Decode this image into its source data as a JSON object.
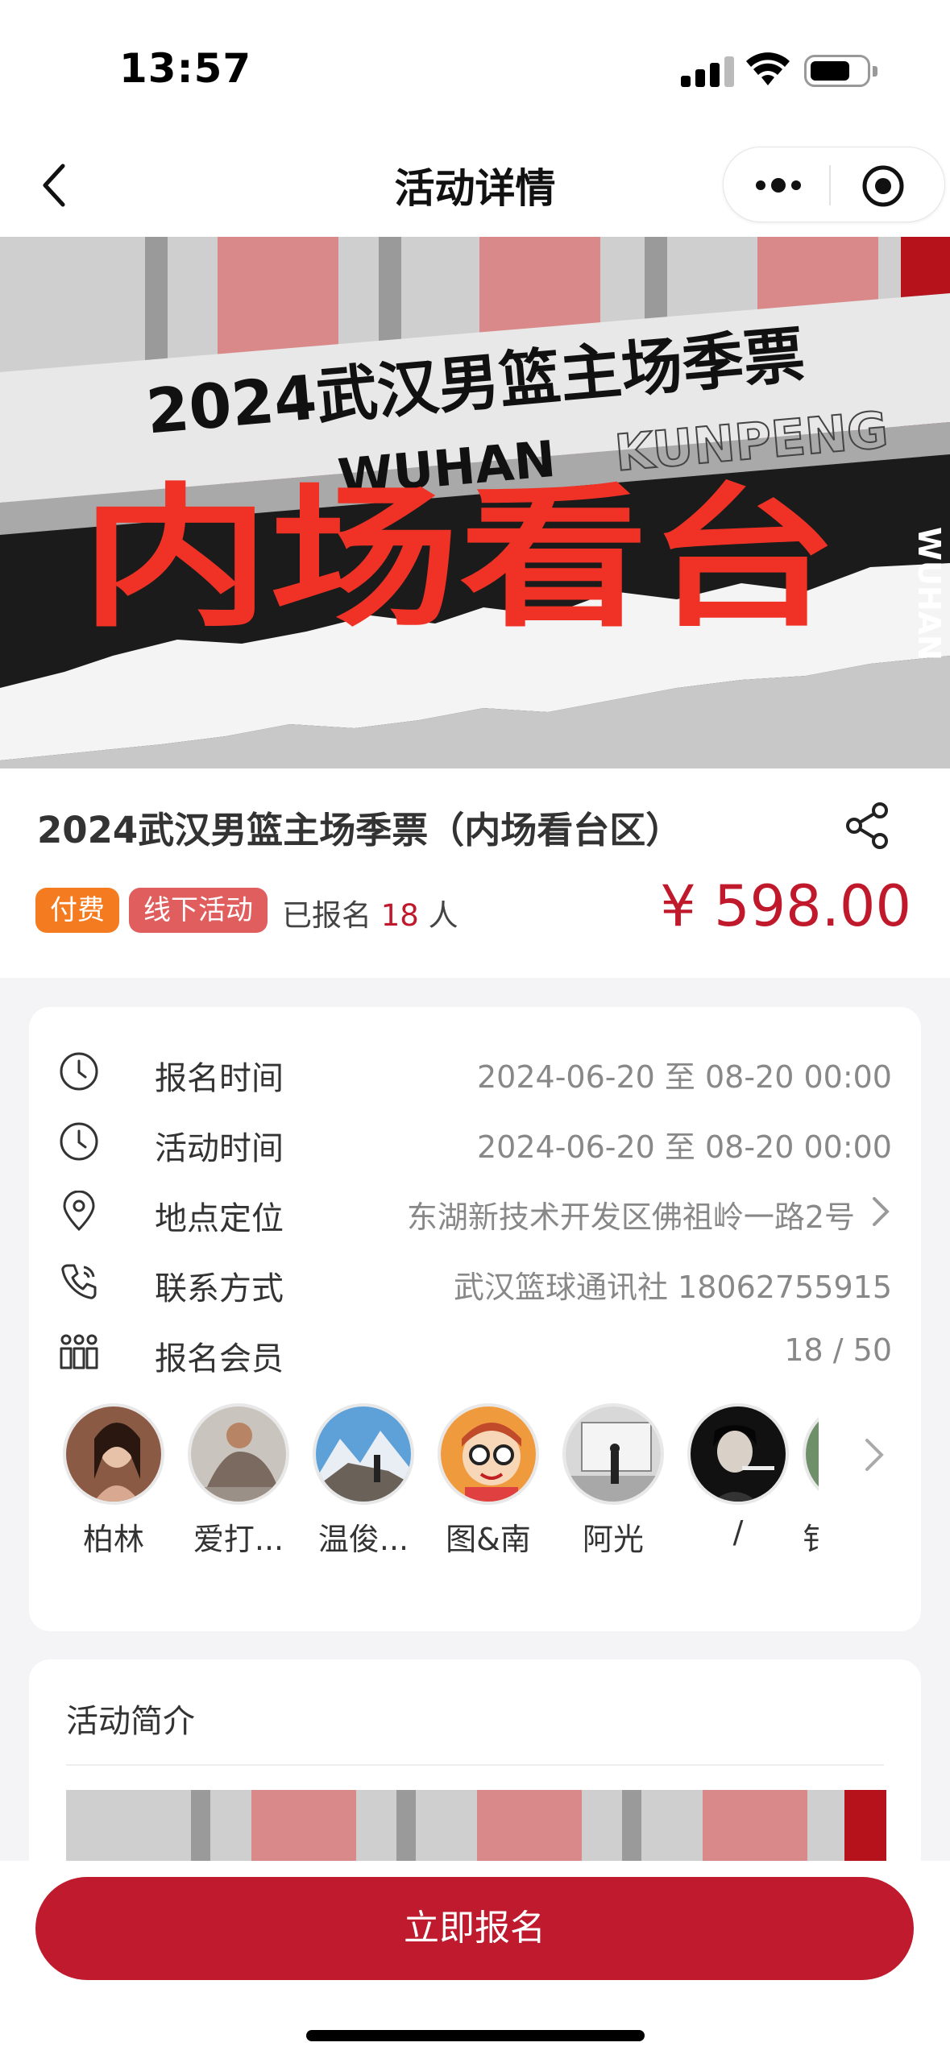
{
  "status_bar": {
    "time": "13:57"
  },
  "nav": {
    "title": "活动详情"
  },
  "banner": {
    "line1": "2024武汉男篮主场季票",
    "line2_left": "WUHAN",
    "line2_right": "KUNPENG",
    "big_text": "内场看台",
    "side_text": "WUHAN"
  },
  "event": {
    "title": "2024武汉男篮主场季票（内场看台区）",
    "tag_paid": "付费",
    "tag_offline": "线下活动",
    "signed_prefix": "已报名",
    "signed_count": "18",
    "signed_suffix": "人",
    "price": "¥ 598.00"
  },
  "details": {
    "signup_time": {
      "label": "报名时间",
      "value": "2024-06-20 至 08-20 00:00"
    },
    "event_time": {
      "label": "活动时间",
      "value": "2024-06-20 至 08-20 00:00"
    },
    "location": {
      "label": "地点定位",
      "value": "东湖新技术开发区佛祖岭一路2号"
    },
    "contact": {
      "label": "联系方式",
      "value": "武汉篮球通讯社 18062755915"
    },
    "members": {
      "label": "报名会员",
      "value": "18 / 50"
    }
  },
  "member_list": [
    {
      "name": "柏林"
    },
    {
      "name": "爱打..."
    },
    {
      "name": "温俊..."
    },
    {
      "name": "图&南"
    },
    {
      "name": "阿光"
    },
    {
      "name": "/"
    },
    {
      "name": "钅"
    }
  ],
  "intro": {
    "title": "活动简介"
  },
  "bottom": {
    "cta": "立即报名"
  },
  "colors": {
    "accent": "#bf1a2d",
    "paid_tag": "#f47b1f",
    "offline_tag": "#e05e5e"
  }
}
